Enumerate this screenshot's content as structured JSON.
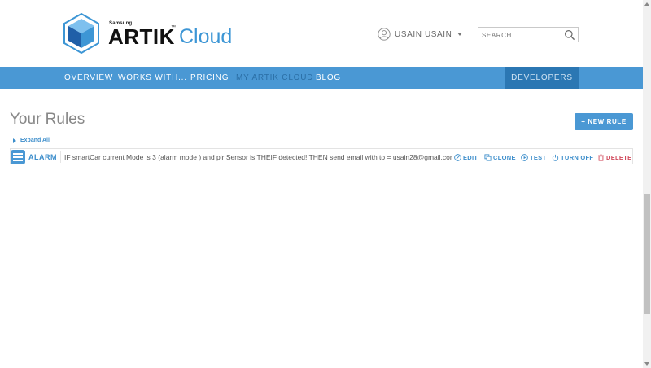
{
  "header": {
    "logo": {
      "brand_small": "Samsung",
      "brand_main": "ARTIK",
      "brand_tm": "™",
      "brand_cloud": "Cloud"
    },
    "user": {
      "name": "USAIN USAIN"
    },
    "search": {
      "placeholder": "SEARCH"
    }
  },
  "nav": {
    "items": [
      {
        "label": "OVERVIEW"
      },
      {
        "label": "WORKS WITH..."
      },
      {
        "label": "PRICING"
      },
      {
        "label": "MY ARTIK CLOUD"
      },
      {
        "label": "BLOG"
      }
    ],
    "active_index": 3,
    "developers_label": "DEVELOPERS"
  },
  "main": {
    "title": "Your Rules",
    "new_rule_label": "+ NEW RULE",
    "expand_all_label": "Expand All",
    "rules": [
      {
        "name": "ALARM",
        "description": "IF smartCar current Mode is 3 (alarm mode ) and pir Sensor is THEIF detected! THEN send email with to = usain28@gmail.com",
        "actions": {
          "edit": "EDIT",
          "clone": "CLONE",
          "test": "TEST",
          "turn_off": "TURN OFF",
          "delete": "DELETE"
        }
      }
    ]
  },
  "colors": {
    "accent": "#4a98d4",
    "nav_active": "#2b6fa6",
    "developers_bg": "#2b77b3",
    "delete": "#d14a5c",
    "title": "#888888"
  }
}
